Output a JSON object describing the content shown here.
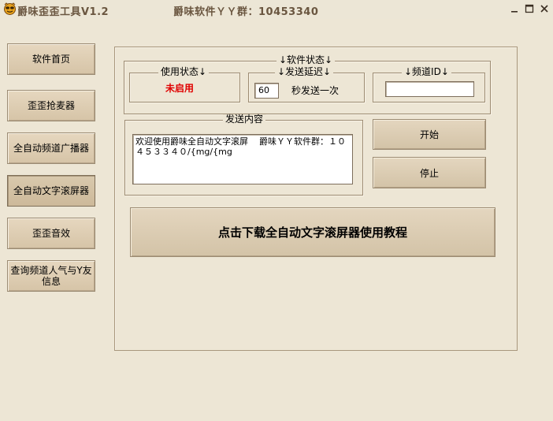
{
  "window": {
    "title": "爵味歪歪工具V1.2",
    "yy_info": "爵味软件ＹＹ群：10453340",
    "min_icon": "minimize-icon",
    "max_icon": "maximize-icon",
    "close_icon": "close-icon"
  },
  "sidebar": {
    "items": [
      {
        "label": "软件首页"
      },
      {
        "label": "歪歪抢麦器"
      },
      {
        "label": "全自动频道广播器"
      },
      {
        "label": "全自动文字滚屏器"
      },
      {
        "label": "歪歪音效"
      },
      {
        "label": "查询频道人气与Y友信息"
      }
    ]
  },
  "software_status": {
    "legend": "↓软件状态↓",
    "usage": {
      "legend": "使用状态↓",
      "value": "未启用",
      "color": "#e00000"
    },
    "delay": {
      "legend": "↓发送延迟↓",
      "value": "60",
      "suffix": "秒发送一次"
    },
    "channel": {
      "legend": "↓频道ID↓",
      "value": ""
    }
  },
  "send_content": {
    "legend": "发送内容",
    "text": "欢迎使用爵味全自动文字滚屏    爵味ＹＹ软件群：１０４５３３４０/{mg/{mg"
  },
  "buttons": {
    "start": "开始",
    "stop": "停止",
    "tutorial": "点击下载全自动文字滚屏器使用教程"
  }
}
